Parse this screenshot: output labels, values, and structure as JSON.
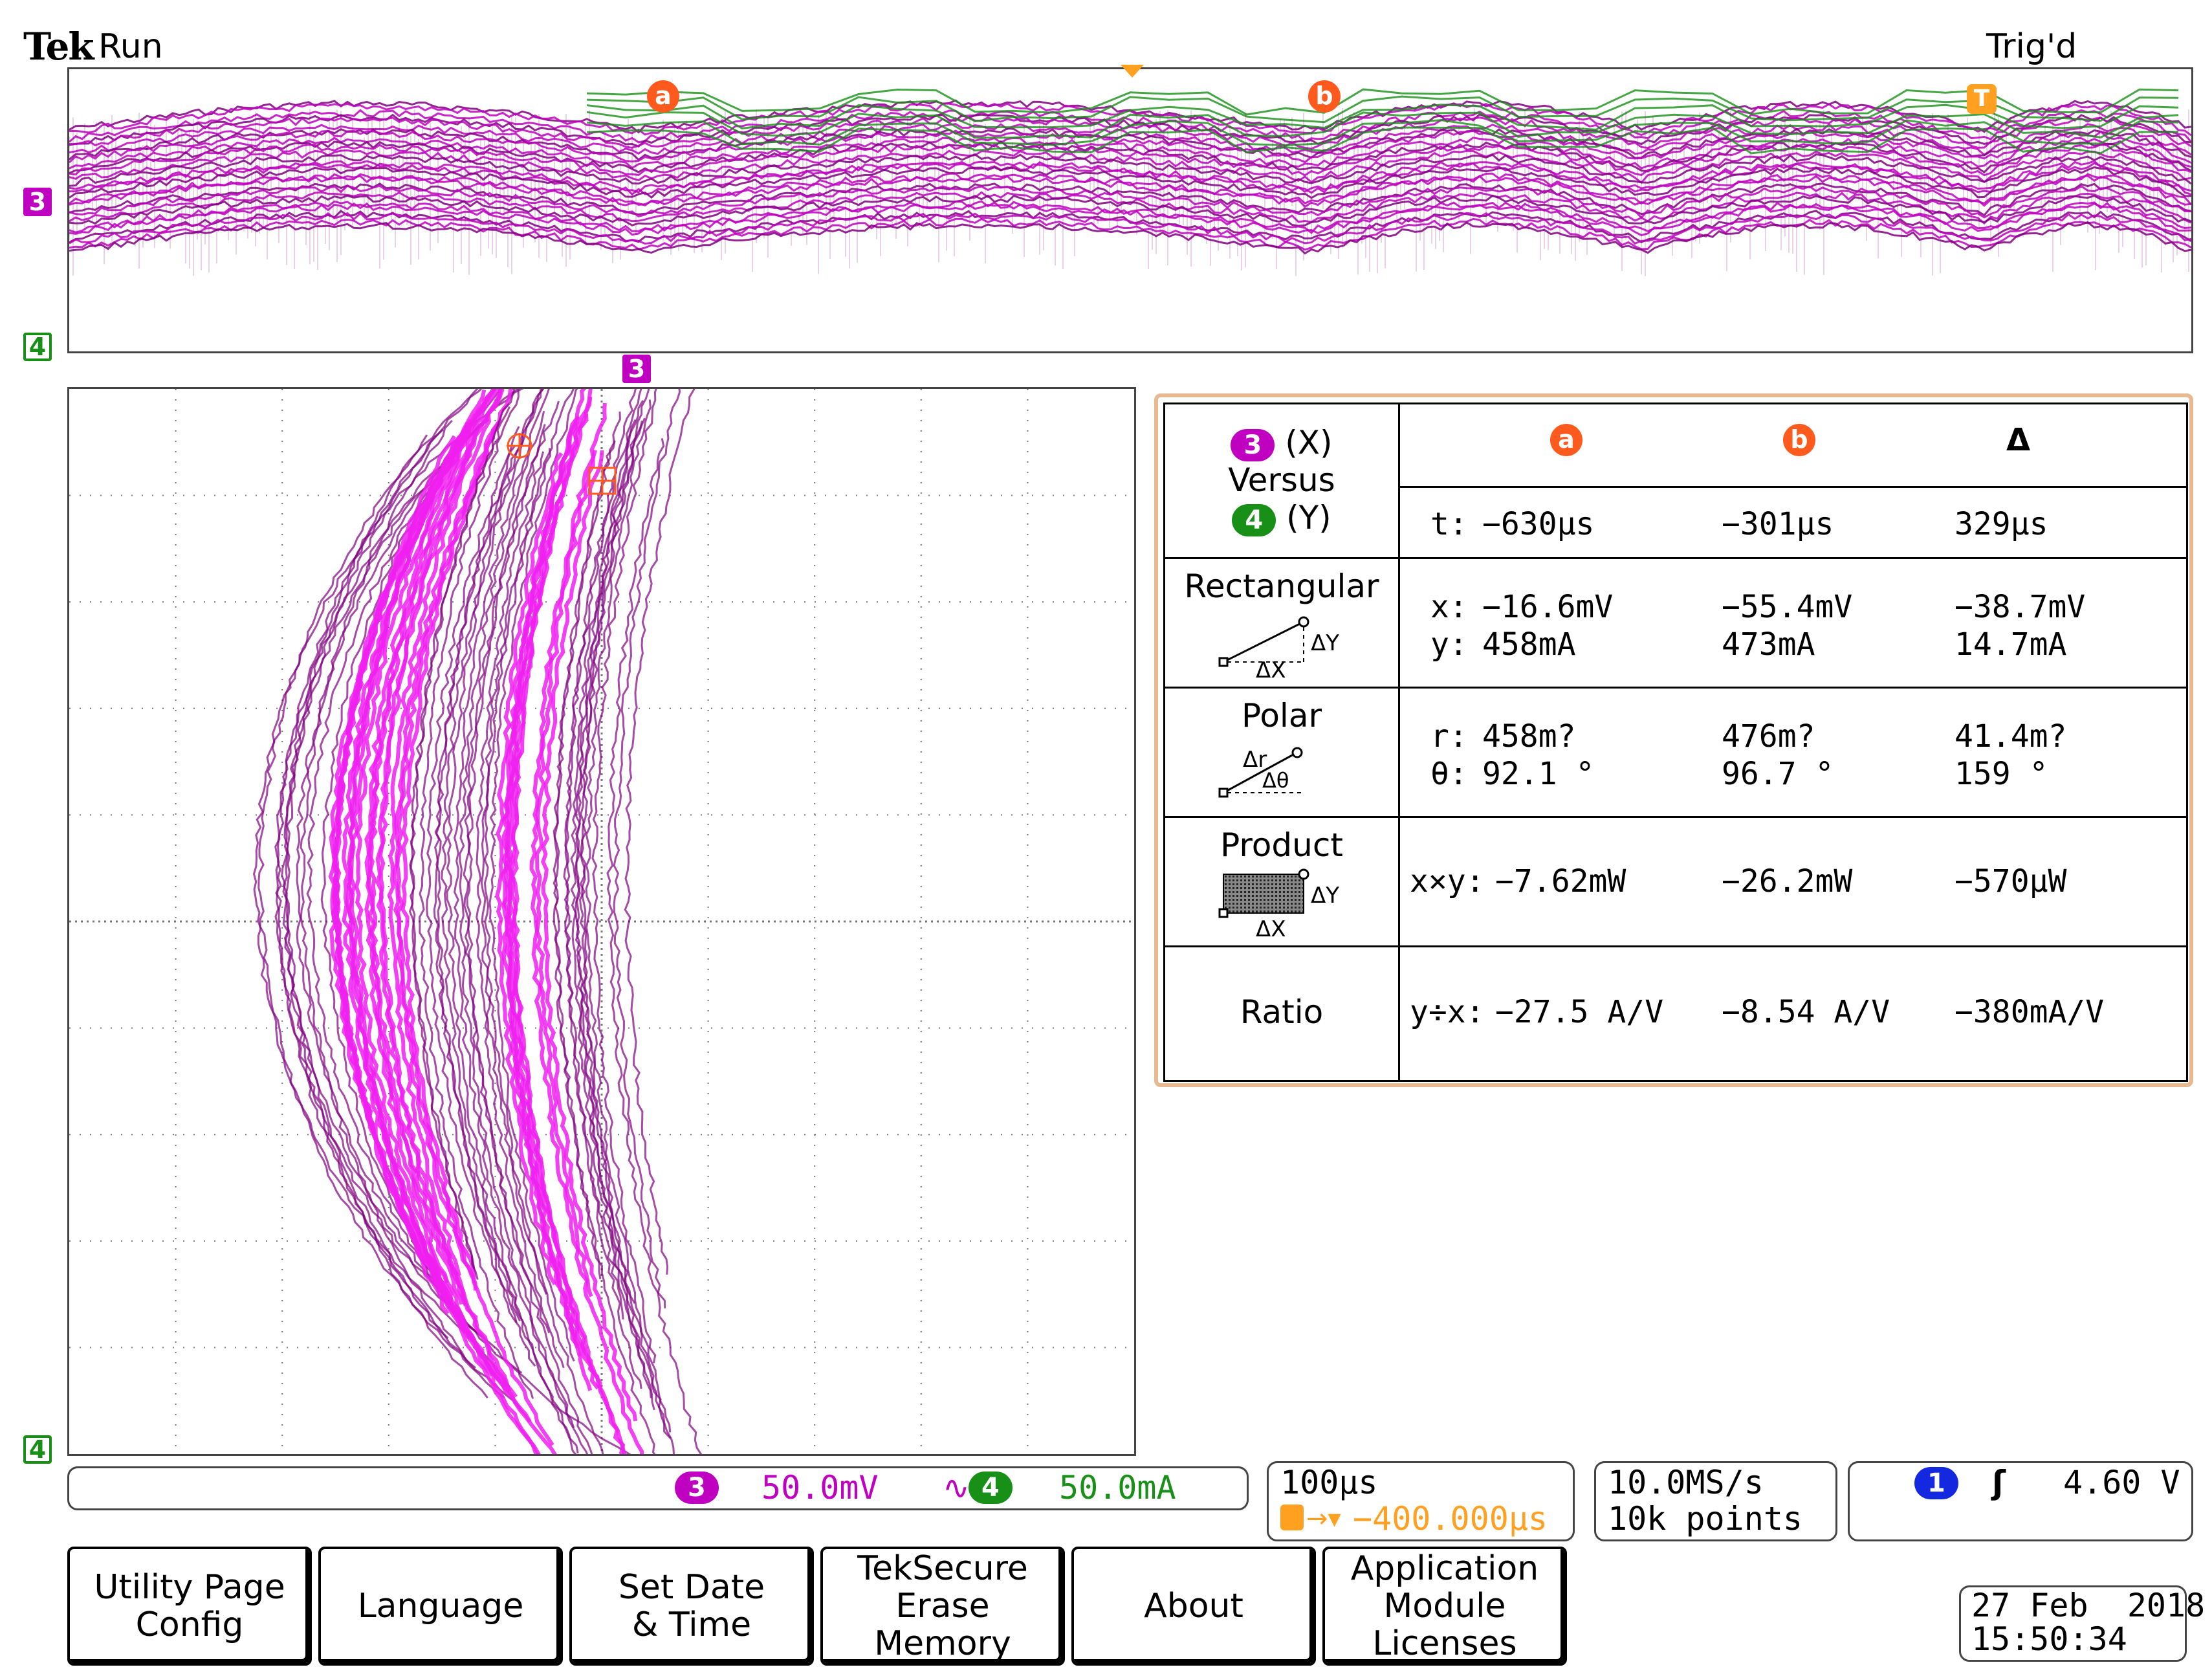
{
  "header": {
    "brand": "Tek",
    "acq_state": "Run",
    "trigger_state": "Trig'd"
  },
  "markers": {
    "ch3": "3",
    "ch4": "4",
    "cursor_a": "a",
    "cursor_b": "b",
    "trigger": "T"
  },
  "colors": {
    "ch3": "#c000c0",
    "ch3_dark": "#800080",
    "ch4": "#189018",
    "cursor": "#ff5a1e",
    "trigger": "#ffa020",
    "ch1": "#1428e0"
  },
  "cursor_table": {
    "source_x": "3",
    "source_x_suffix": "(X)",
    "versus": "Versus",
    "source_y": "4",
    "source_y_suffix": "(Y)",
    "col_a": "a",
    "col_b": "b",
    "col_delta": "Δ",
    "time": {
      "label": "t:",
      "a": "−630µs",
      "b": "−301µs",
      "delta": "329µs"
    },
    "rectangular": {
      "title": "Rectangular",
      "icon_dy": "ΔY",
      "icon_dx": "ΔX",
      "x_label": "x:",
      "y_label": "y:",
      "x_a": "−16.6mV",
      "x_b": "−55.4mV",
      "x_delta": "−38.7mV",
      "y_a": "458mA",
      "y_b": "473mA",
      "y_delta": "14.7mA"
    },
    "polar": {
      "title": "Polar",
      "icon_dr": "Δr",
      "icon_dtheta": "Δθ",
      "r_label": "r:",
      "theta_label": "θ:",
      "r_a": "458m?",
      "r_b": "476m?",
      "r_delta": "41.4m?",
      "theta_a": "92.1 °",
      "theta_b": "96.7 °",
      "theta_delta": "159 °"
    },
    "product": {
      "title": "Product",
      "icon_dy": "ΔY",
      "icon_dx": "ΔX",
      "label": "x×y:",
      "a": "−7.62mW",
      "b": "−26.2mW",
      "delta": "−570µW"
    },
    "ratio": {
      "title": "Ratio",
      "label": "y÷x:",
      "a": "−27.5 A/V",
      "b": "−8.54 A/V",
      "delta": "−380mA/V"
    }
  },
  "status": {
    "ch3_num": "3",
    "ch3_scale": "50.0mV",
    "ch3_coupling": "∿",
    "ch4_num": "4",
    "ch4_scale": "50.0mA",
    "timebase": "100µs",
    "trigger_pos": "−400.000µs",
    "sample_rate": "10.0MS/s",
    "record_length": "10k points",
    "trig_source": "1",
    "trig_slope": "ʃ",
    "trig_level": "4.60 V"
  },
  "softkeys": [
    {
      "label": "Utility Page\nConfig"
    },
    {
      "label": "Language"
    },
    {
      "label": "Set Date\n& Time"
    },
    {
      "label": "TekSecure\nErase\nMemory"
    },
    {
      "label": "About"
    },
    {
      "label": "Application\nModule\nLicenses"
    }
  ],
  "datetime": {
    "date": "27 Feb  2018",
    "time": "15:50:34"
  }
}
